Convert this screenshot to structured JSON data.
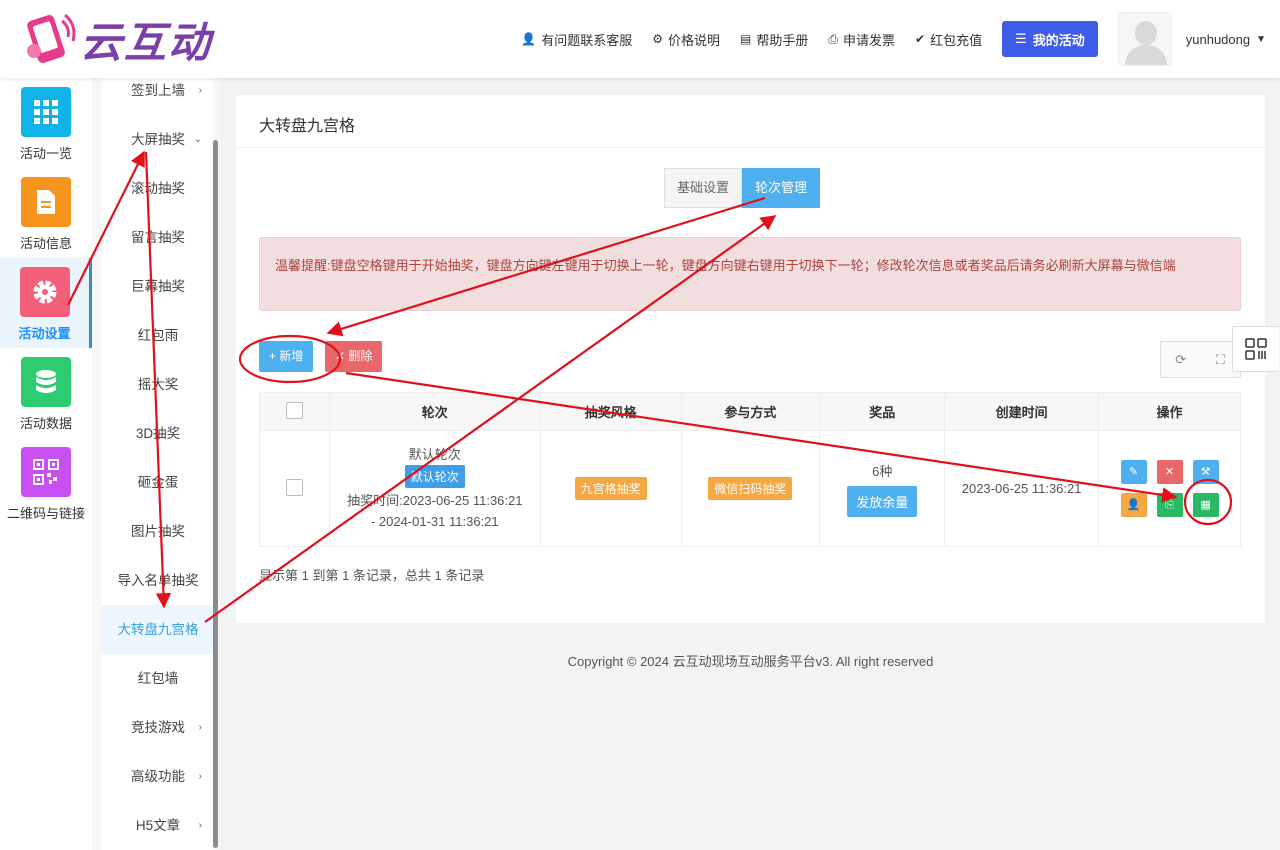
{
  "brand": {
    "name": "云互动"
  },
  "header": {
    "nav": [
      {
        "icon": "user-plus-icon",
        "glyph": "👤",
        "label": "有问题联系客服"
      },
      {
        "icon": "coin-icon",
        "glyph": "⚙",
        "label": "价格说明"
      },
      {
        "icon": "book-icon",
        "glyph": "▤",
        "label": "帮助手册"
      },
      {
        "icon": "printer-icon",
        "glyph": "⎙",
        "label": "申请发票"
      },
      {
        "icon": "shield-check-icon",
        "glyph": "✔",
        "label": "红包充值"
      }
    ],
    "my_activity": "我的活动",
    "username": "yunhudong"
  },
  "sidebar": {
    "items": [
      {
        "label": "活动一览",
        "icon": "grid-icon",
        "color": "#12b3e8"
      },
      {
        "label": "活动信息",
        "icon": "document-icon",
        "color": "#f7941d"
      },
      {
        "label": "活动设置",
        "icon": "gear-icon",
        "color": "#f4607a"
      },
      {
        "label": "活动数据",
        "icon": "database-icon",
        "color": "#2ecc71"
      },
      {
        "label": "二维码与链接",
        "icon": "qrcode-icon",
        "color": "#c84ff0"
      }
    ]
  },
  "submenu": {
    "items": [
      {
        "label": "签到上墙",
        "arrow": "›"
      },
      {
        "label": "大屏抽奖",
        "arrow": "⌄"
      },
      {
        "label": "滚动抽奖",
        "arrow": ""
      },
      {
        "label": "留言抽奖",
        "arrow": ""
      },
      {
        "label": "巨幕抽奖",
        "arrow": ""
      },
      {
        "label": "红包雨",
        "arrow": ""
      },
      {
        "label": "摇大奖",
        "arrow": ""
      },
      {
        "label": "3D抽奖",
        "arrow": ""
      },
      {
        "label": "砸金蛋",
        "arrow": ""
      },
      {
        "label": "图片抽奖",
        "arrow": ""
      },
      {
        "label": "导入名单抽奖",
        "arrow": ""
      },
      {
        "label": "大转盘九宫格",
        "arrow": ""
      },
      {
        "label": "红包墙",
        "arrow": ""
      },
      {
        "label": "竞技游戏",
        "arrow": "›"
      },
      {
        "label": "高级功能",
        "arrow": "›"
      },
      {
        "label": "H5文章",
        "arrow": "›"
      }
    ]
  },
  "main": {
    "title": "大转盘九宫格",
    "tabs": [
      "基础设置",
      "轮次管理"
    ],
    "alert": "温馨提醒:键盘空格键用于开始抽奖，键盘方向键左键用于切换上一轮，键盘方向键右键用于切换下一轮；修改轮次信息或者奖品后请务必刷新大屏幕与微信端",
    "add_label": "+ 新增",
    "delete_label": "✕ 删除",
    "table": {
      "headers": [
        "轮次",
        "抽奖风格",
        "参与方式",
        "奖品",
        "创建时间",
        "操作"
      ],
      "row": {
        "round_name": "默认轮次",
        "round_tag": "默认轮次",
        "time_range_1": "抽奖时间:2023-06-25 11:36:21",
        "time_range_2": "- 2024-01-31 11:36:21",
        "style": "九宫格抽奖",
        "join_mode": "微信扫码抽奖",
        "prize_count": "6种",
        "prize_button": "发放余量",
        "created": "2023-06-25 11:36:21"
      }
    },
    "pagination_info": "显示第 1 到第 1 条记录，总共 1 条记录"
  },
  "footer": {
    "copyright": "Copyright © 2024 云互动现场互动服务平台v3. All right reserved"
  },
  "annotation_color": "#e0101c"
}
